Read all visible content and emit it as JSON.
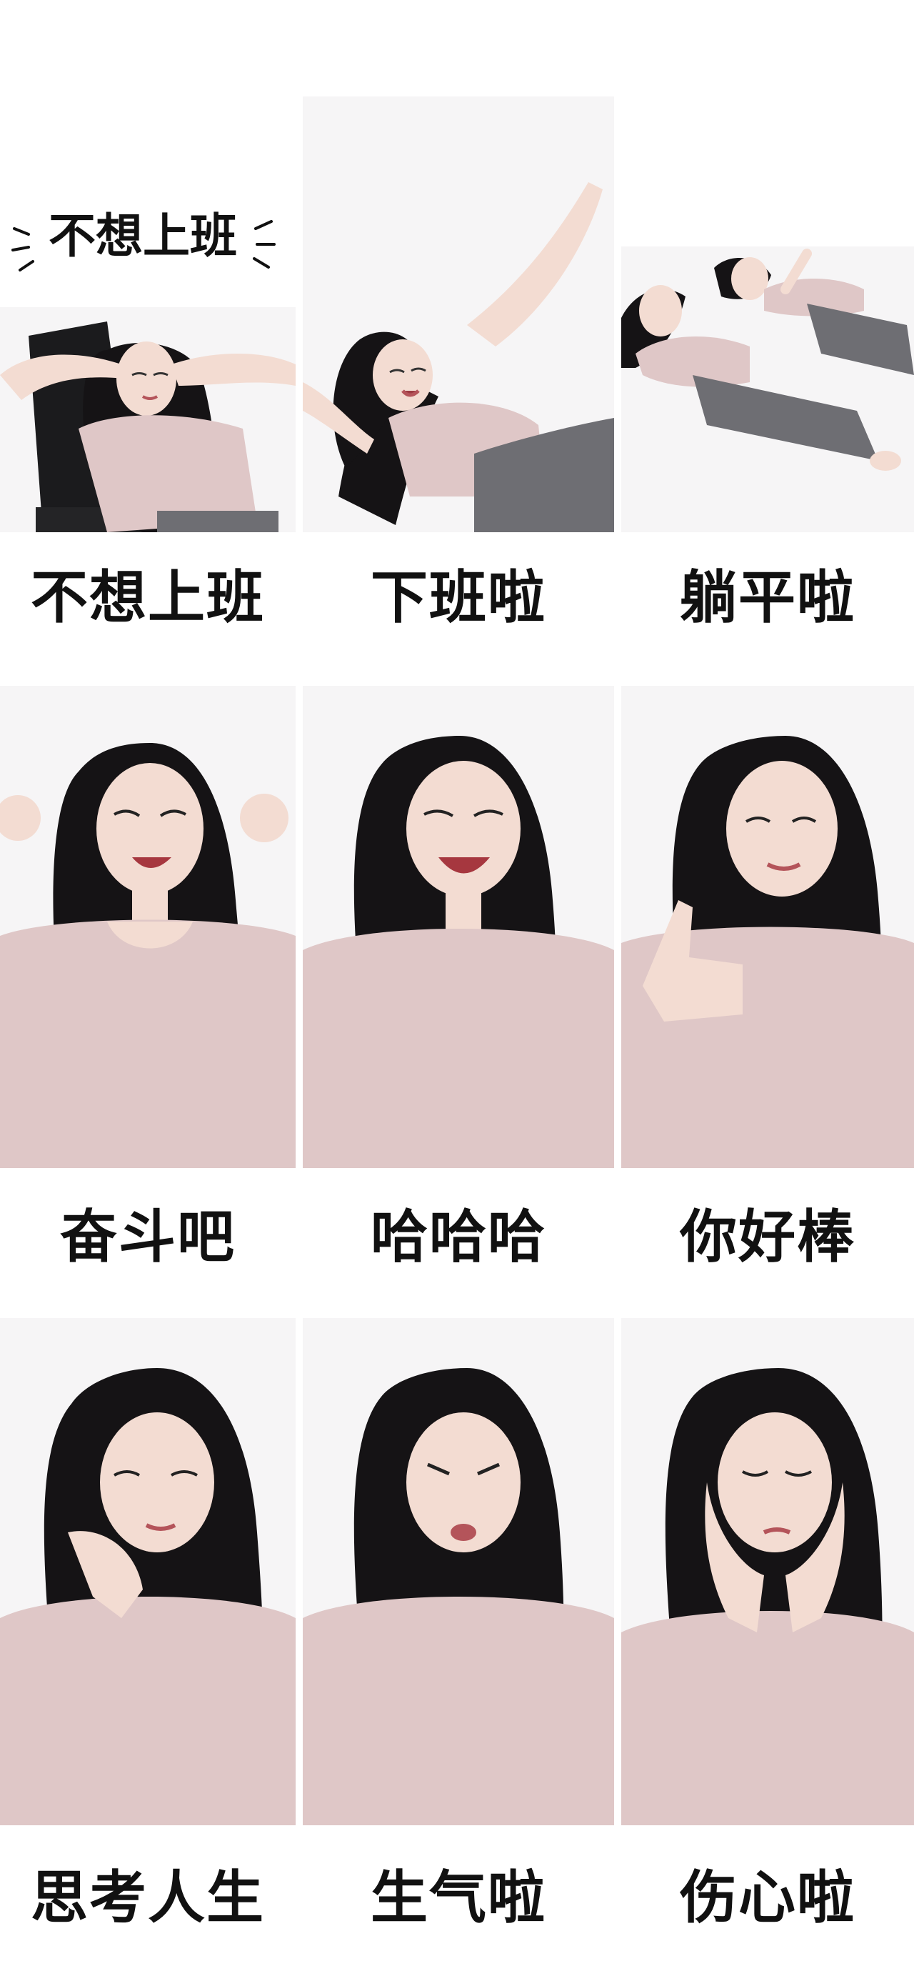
{
  "speech_bubble": "不想上班",
  "stickers": [
    {
      "label": "不想上班",
      "icon": "reclining-in-chair",
      "colors": {
        "skin": "#f3dcd2",
        "hair": "#151315",
        "top": "#dfc7c7",
        "pants": "#6e6e73",
        "chair": "#1b1b1d"
      }
    },
    {
      "label": "下班啦",
      "icon": "leaning-back-arm-raised",
      "colors": {
        "skin": "#f3dcd2",
        "hair": "#151315",
        "top": "#dfc7c7",
        "pants": "#6e6e73"
      }
    },
    {
      "label": "躺平啦",
      "icon": "lying-flat",
      "colors": {
        "skin": "#f3dcd2",
        "hair": "#151315",
        "top": "#dfc7c7",
        "pants": "#6e6e73"
      }
    },
    {
      "label": "奋斗吧",
      "icon": "flexing-fists",
      "colors": {
        "skin": "#f3dcd2",
        "hair": "#151315",
        "top": "#dfc7c7"
      }
    },
    {
      "label": "哈哈哈",
      "icon": "laughing",
      "colors": {
        "skin": "#f3dcd2",
        "hair": "#151315",
        "top": "#dfc7c7"
      }
    },
    {
      "label": "你好棒",
      "icon": "thumbs-up",
      "colors": {
        "skin": "#f3dcd2",
        "hair": "#151315",
        "top": "#dfc7c7"
      }
    },
    {
      "label": "思考人生",
      "icon": "chin-on-hand",
      "colors": {
        "skin": "#f3dcd2",
        "hair": "#151315",
        "top": "#dfc7c7"
      }
    },
    {
      "label": "生气啦",
      "icon": "pouting",
      "colors": {
        "skin": "#f3dcd2",
        "hair": "#151315",
        "top": "#dfc7c7"
      }
    },
    {
      "label": "伤心啦",
      "icon": "hands-on-face",
      "colors": {
        "skin": "#f3dcd2",
        "hair": "#151315",
        "top": "#dfc7c7"
      }
    }
  ]
}
